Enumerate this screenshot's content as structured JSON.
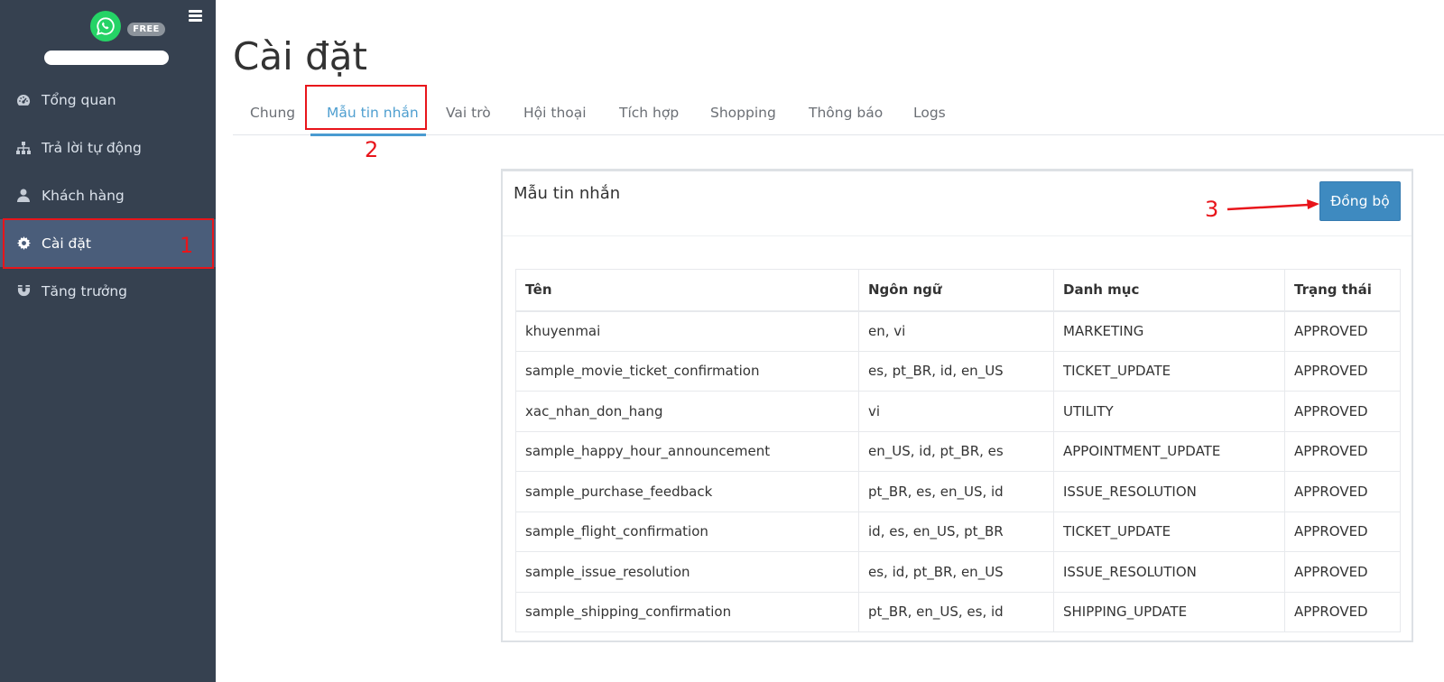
{
  "sidebar": {
    "free_badge": "FREE",
    "items": [
      {
        "label": "Tổng quan",
        "icon": "dashboard-icon"
      },
      {
        "label": "Trả lời tự động",
        "icon": "sitemap-icon"
      },
      {
        "label": "Khách hàng",
        "icon": "user-icon"
      },
      {
        "label": "Cài đặt",
        "icon": "gear-icon",
        "active": true
      },
      {
        "label": "Tăng trưởng",
        "icon": "magnet-icon"
      }
    ]
  },
  "page": {
    "title": "Cài đặt"
  },
  "tabs": [
    {
      "label": "Chung"
    },
    {
      "label": "Mẫu tin nhắn",
      "active": true
    },
    {
      "label": "Vai trò"
    },
    {
      "label": "Hội thoại"
    },
    {
      "label": "Tích hợp"
    },
    {
      "label": "Shopping"
    },
    {
      "label": "Thông báo"
    },
    {
      "label": "Logs"
    }
  ],
  "annotations": {
    "n1": "1",
    "n2": "2",
    "n3": "3"
  },
  "card": {
    "title": "Mẫu tin nhắn",
    "sync_label": "Đồng bộ",
    "columns": [
      "Tên",
      "Ngôn ngữ",
      "Danh mục",
      "Trạng thái"
    ],
    "rows": [
      [
        "khuyenmai",
        "en, vi",
        "MARKETING",
        "APPROVED"
      ],
      [
        "sample_movie_ticket_confirmation",
        "es, pt_BR, id, en_US",
        "TICKET_UPDATE",
        "APPROVED"
      ],
      [
        "xac_nhan_don_hang",
        "vi",
        "UTILITY",
        "APPROVED"
      ],
      [
        "sample_happy_hour_announcement",
        "en_US, id, pt_BR, es",
        "APPOINTMENT_UPDATE",
        "APPROVED"
      ],
      [
        "sample_purchase_feedback",
        "pt_BR, es, en_US, id",
        "ISSUE_RESOLUTION",
        "APPROVED"
      ],
      [
        "sample_flight_confirmation",
        "id, es, en_US, pt_BR",
        "TICKET_UPDATE",
        "APPROVED"
      ],
      [
        "sample_issue_resolution",
        "es, id, pt_BR, en_US",
        "ISSUE_RESOLUTION",
        "APPROVED"
      ],
      [
        "sample_shipping_confirmation",
        "pt_BR, en_US, es, id",
        "SHIPPING_UPDATE",
        "APPROVED"
      ]
    ]
  },
  "colors": {
    "sidebar_bg": "#364150",
    "sidebar_active": "#4a5d7a",
    "accent": "#4a9bd1",
    "button": "#3e8ac0",
    "annotation": "#e8151b",
    "whatsapp": "#25d366"
  }
}
